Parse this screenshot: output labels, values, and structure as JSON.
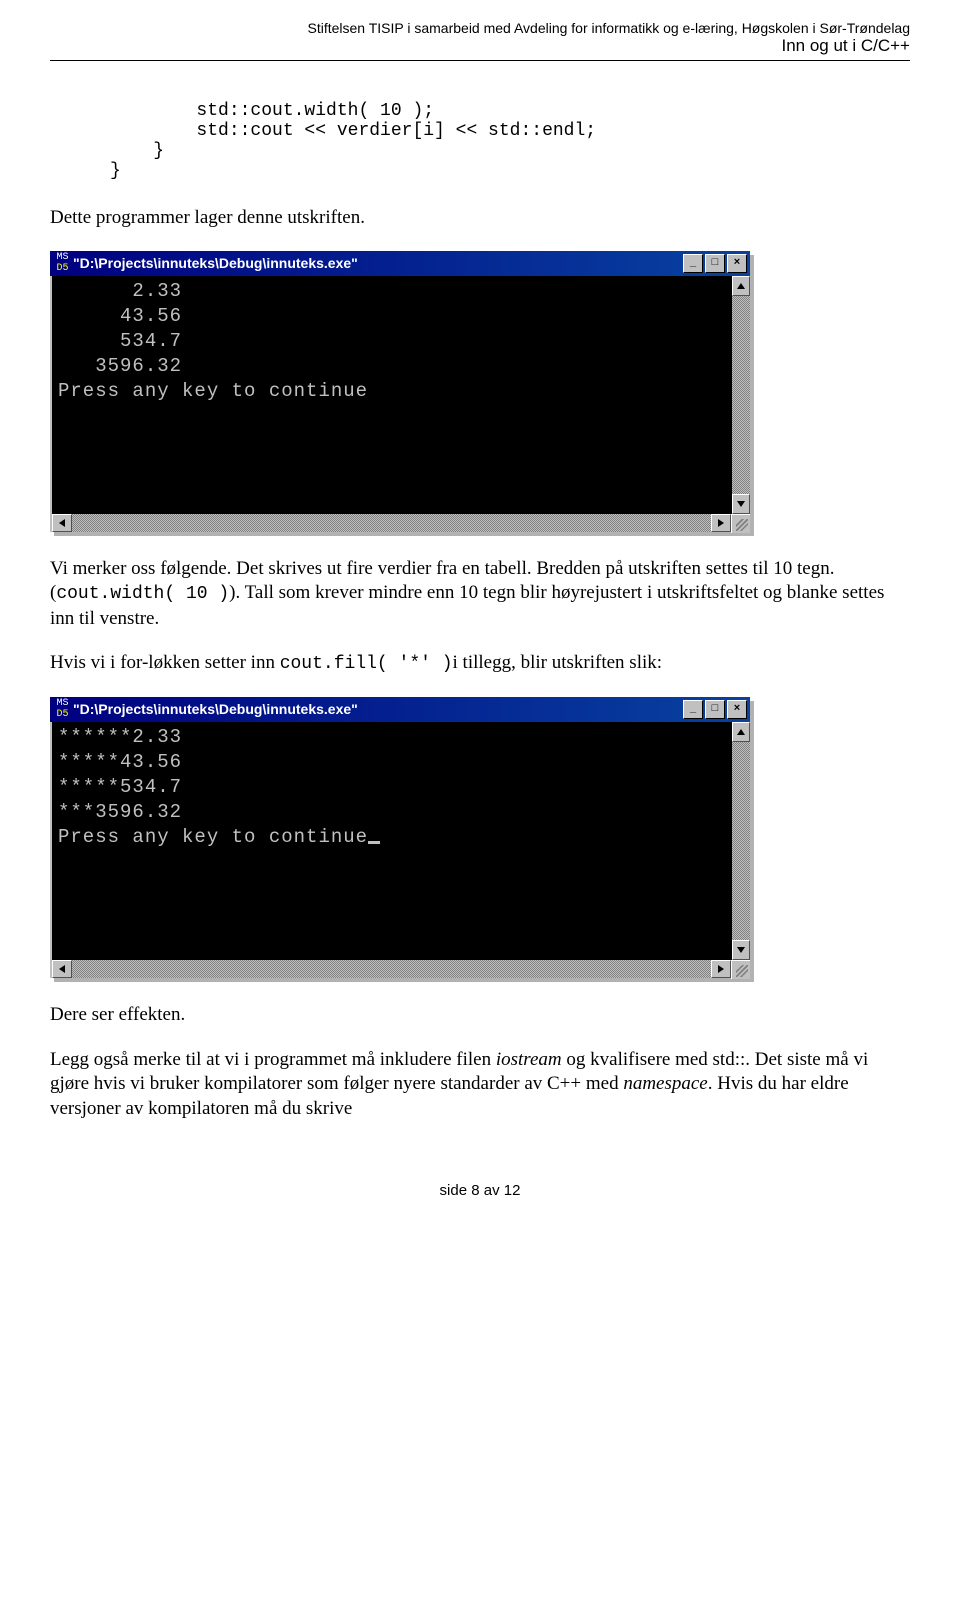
{
  "header": {
    "line1": "Stiftelsen TISIP i samarbeid med Avdeling for informatikk og e-læring, Høgskolen i Sør-Trøndelag",
    "line2": "Inn og ut i C/C++"
  },
  "code": "        std::cout.width( 10 );\n        std::cout << verdier[i] << std::endl;\n    }\n}",
  "para1": "Dette programmer lager denne utskriften.",
  "console1": {
    "title": "\"D:\\Projects\\innuteks\\Debug\\innuteks.exe\"",
    "output": "      2.33\n     43.56\n     534.7\n   3596.32\nPress any key to continue",
    "cursor": false
  },
  "para2_a": "Vi merker oss følgende. Det skrives ut fire verdier fra en tabell. Bredden på utskriften settes til 10 tegn. (",
  "para2_code1": "cout.width( 10 )",
  "para2_b": "). Tall som krever mindre enn 10 tegn blir høyrejustert i utskriftsfeltet og blanke settes inn til venstre.",
  "para3_a": "Hvis vi i for-løkken setter inn ",
  "para3_code1": "cout.fill( '*' )",
  "para3_b": "i tillegg, blir utskriften slik:",
  "console2": {
    "title": "\"D:\\Projects\\innuteks\\Debug\\innuteks.exe\"",
    "output": "******2.33\n*****43.56\n*****534.7\n***3596.32\nPress any key to continue",
    "cursor": true
  },
  "para4": "Dere ser effekten.",
  "para5_a": "Legg også merke til at vi i programmet må inkludere filen ",
  "para5_i1": "iostream",
  "para5_b": " og kvalifisere med std::. Det siste må vi gjøre hvis vi bruker kompilatorer som følger nyere standarder av C++ med ",
  "para5_i2": "namespace",
  "para5_c": ". Hvis du har eldre versjoner av kompilatoren må du skrive",
  "footer": "side 8 av 12",
  "buttons": {
    "min": "_",
    "max": "□",
    "close": "×"
  }
}
